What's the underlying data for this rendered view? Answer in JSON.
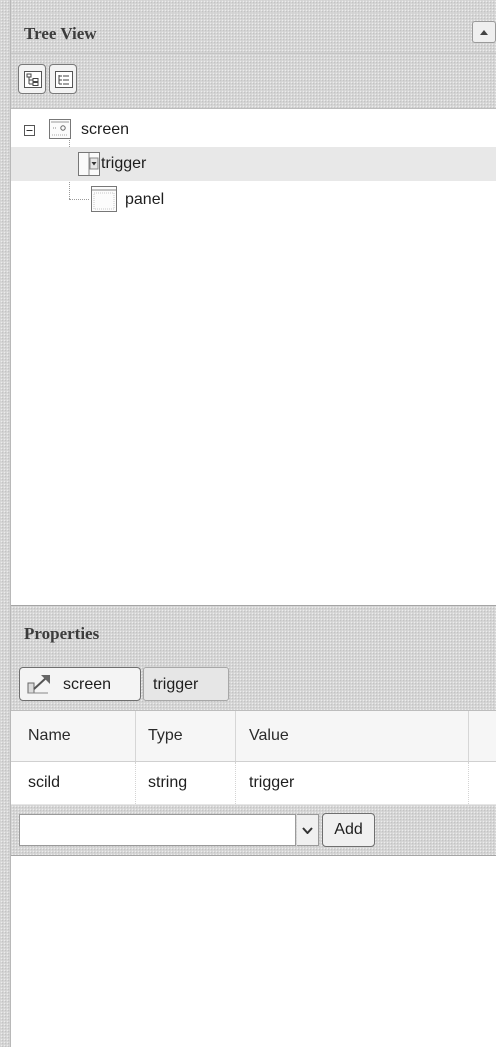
{
  "tree_view": {
    "title": "Tree View",
    "collapse_icon": "chevron-up-icon",
    "toolbar": [
      {
        "icon": "expand-tree-icon"
      },
      {
        "icon": "collapse-tree-icon"
      }
    ],
    "nodes": [
      {
        "label": "screen",
        "icon": "screen-node-icon",
        "expanded": true,
        "selected": false
      },
      {
        "label": "trigger",
        "icon": "trigger-node-icon",
        "selected": true
      },
      {
        "label": "panel",
        "icon": "panel-node-icon",
        "selected": false
      }
    ]
  },
  "properties": {
    "title": "Properties",
    "breadcrumb": [
      {
        "label": "screen",
        "icon": "up-arrow-icon"
      },
      {
        "label": "trigger"
      }
    ],
    "columns": [
      "Name",
      "Type",
      "Value"
    ],
    "rows": [
      {
        "name": "scild",
        "type": "string",
        "value": "trigger"
      }
    ],
    "add_bar": {
      "input_value": "",
      "add_label": "Add"
    }
  }
}
